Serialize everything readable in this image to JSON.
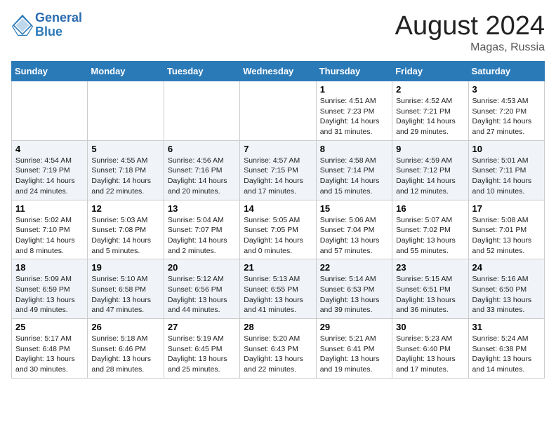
{
  "header": {
    "logo_line1": "General",
    "logo_line2": "Blue",
    "month": "August 2024",
    "location": "Magas, Russia"
  },
  "columns": [
    "Sunday",
    "Monday",
    "Tuesday",
    "Wednesday",
    "Thursday",
    "Friday",
    "Saturday"
  ],
  "weeks": [
    [
      {
        "day": "",
        "detail": ""
      },
      {
        "day": "",
        "detail": ""
      },
      {
        "day": "",
        "detail": ""
      },
      {
        "day": "",
        "detail": ""
      },
      {
        "day": "1",
        "detail": "Sunrise: 4:51 AM\nSunset: 7:23 PM\nDaylight: 14 hours\nand 31 minutes."
      },
      {
        "day": "2",
        "detail": "Sunrise: 4:52 AM\nSunset: 7:21 PM\nDaylight: 14 hours\nand 29 minutes."
      },
      {
        "day": "3",
        "detail": "Sunrise: 4:53 AM\nSunset: 7:20 PM\nDaylight: 14 hours\nand 27 minutes."
      }
    ],
    [
      {
        "day": "4",
        "detail": "Sunrise: 4:54 AM\nSunset: 7:19 PM\nDaylight: 14 hours\nand 24 minutes."
      },
      {
        "day": "5",
        "detail": "Sunrise: 4:55 AM\nSunset: 7:18 PM\nDaylight: 14 hours\nand 22 minutes."
      },
      {
        "day": "6",
        "detail": "Sunrise: 4:56 AM\nSunset: 7:16 PM\nDaylight: 14 hours\nand 20 minutes."
      },
      {
        "day": "7",
        "detail": "Sunrise: 4:57 AM\nSunset: 7:15 PM\nDaylight: 14 hours\nand 17 minutes."
      },
      {
        "day": "8",
        "detail": "Sunrise: 4:58 AM\nSunset: 7:14 PM\nDaylight: 14 hours\nand 15 minutes."
      },
      {
        "day": "9",
        "detail": "Sunrise: 4:59 AM\nSunset: 7:12 PM\nDaylight: 14 hours\nand 12 minutes."
      },
      {
        "day": "10",
        "detail": "Sunrise: 5:01 AM\nSunset: 7:11 PM\nDaylight: 14 hours\nand 10 minutes."
      }
    ],
    [
      {
        "day": "11",
        "detail": "Sunrise: 5:02 AM\nSunset: 7:10 PM\nDaylight: 14 hours\nand 8 minutes."
      },
      {
        "day": "12",
        "detail": "Sunrise: 5:03 AM\nSunset: 7:08 PM\nDaylight: 14 hours\nand 5 minutes."
      },
      {
        "day": "13",
        "detail": "Sunrise: 5:04 AM\nSunset: 7:07 PM\nDaylight: 14 hours\nand 2 minutes."
      },
      {
        "day": "14",
        "detail": "Sunrise: 5:05 AM\nSunset: 7:05 PM\nDaylight: 14 hours\nand 0 minutes."
      },
      {
        "day": "15",
        "detail": "Sunrise: 5:06 AM\nSunset: 7:04 PM\nDaylight: 13 hours\nand 57 minutes."
      },
      {
        "day": "16",
        "detail": "Sunrise: 5:07 AM\nSunset: 7:02 PM\nDaylight: 13 hours\nand 55 minutes."
      },
      {
        "day": "17",
        "detail": "Sunrise: 5:08 AM\nSunset: 7:01 PM\nDaylight: 13 hours\nand 52 minutes."
      }
    ],
    [
      {
        "day": "18",
        "detail": "Sunrise: 5:09 AM\nSunset: 6:59 PM\nDaylight: 13 hours\nand 49 minutes."
      },
      {
        "day": "19",
        "detail": "Sunrise: 5:10 AM\nSunset: 6:58 PM\nDaylight: 13 hours\nand 47 minutes."
      },
      {
        "day": "20",
        "detail": "Sunrise: 5:12 AM\nSunset: 6:56 PM\nDaylight: 13 hours\nand 44 minutes."
      },
      {
        "day": "21",
        "detail": "Sunrise: 5:13 AM\nSunset: 6:55 PM\nDaylight: 13 hours\nand 41 minutes."
      },
      {
        "day": "22",
        "detail": "Sunrise: 5:14 AM\nSunset: 6:53 PM\nDaylight: 13 hours\nand 39 minutes."
      },
      {
        "day": "23",
        "detail": "Sunrise: 5:15 AM\nSunset: 6:51 PM\nDaylight: 13 hours\nand 36 minutes."
      },
      {
        "day": "24",
        "detail": "Sunrise: 5:16 AM\nSunset: 6:50 PM\nDaylight: 13 hours\nand 33 minutes."
      }
    ],
    [
      {
        "day": "25",
        "detail": "Sunrise: 5:17 AM\nSunset: 6:48 PM\nDaylight: 13 hours\nand 30 minutes."
      },
      {
        "day": "26",
        "detail": "Sunrise: 5:18 AM\nSunset: 6:46 PM\nDaylight: 13 hours\nand 28 minutes."
      },
      {
        "day": "27",
        "detail": "Sunrise: 5:19 AM\nSunset: 6:45 PM\nDaylight: 13 hours\nand 25 minutes."
      },
      {
        "day": "28",
        "detail": "Sunrise: 5:20 AM\nSunset: 6:43 PM\nDaylight: 13 hours\nand 22 minutes."
      },
      {
        "day": "29",
        "detail": "Sunrise: 5:21 AM\nSunset: 6:41 PM\nDaylight: 13 hours\nand 19 minutes."
      },
      {
        "day": "30",
        "detail": "Sunrise: 5:23 AM\nSunset: 6:40 PM\nDaylight: 13 hours\nand 17 minutes."
      },
      {
        "day": "31",
        "detail": "Sunrise: 5:24 AM\nSunset: 6:38 PM\nDaylight: 13 hours\nand 14 minutes."
      }
    ]
  ]
}
